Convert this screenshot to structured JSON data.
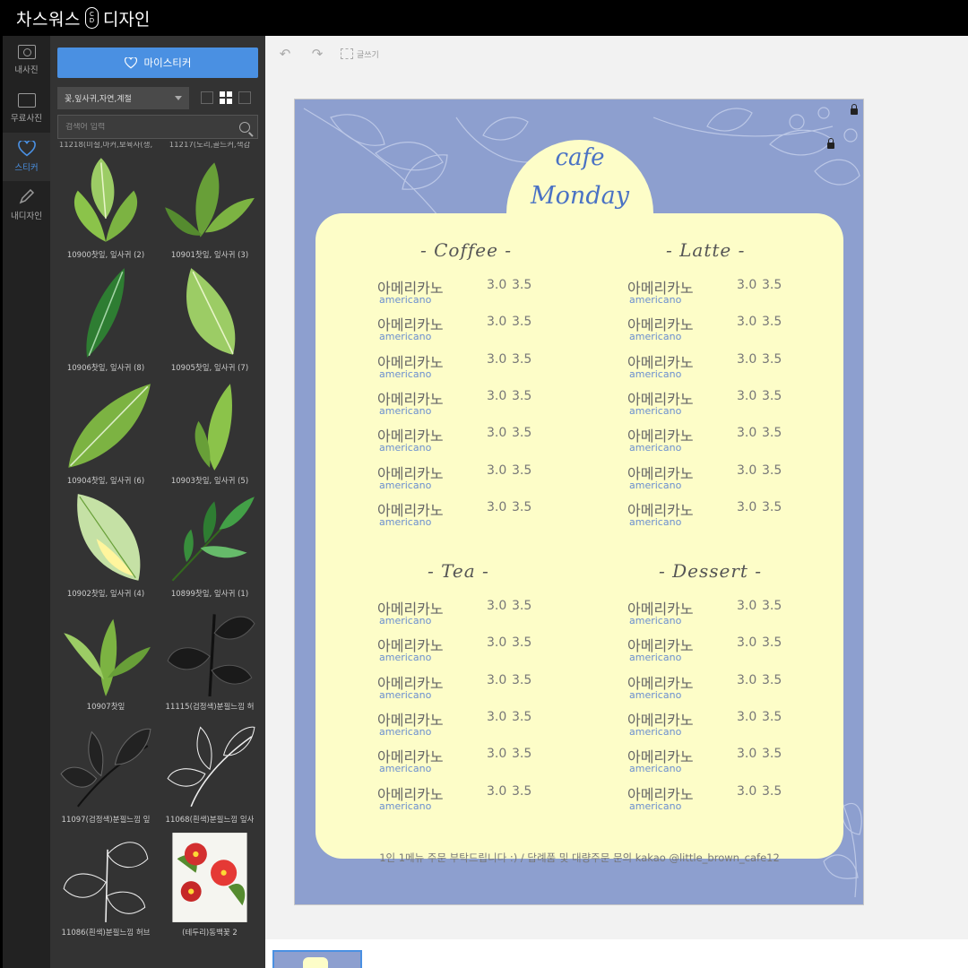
{
  "app": {
    "title_left": "차스워스",
    "logo_letters": [
      "C",
      "D"
    ],
    "title_right": "디자인"
  },
  "rail": [
    {
      "label": "내사진",
      "active": false
    },
    {
      "label": "무료사진",
      "active": false
    },
    {
      "label": "스티커",
      "active": true
    },
    {
      "label": "내디자인",
      "active": false
    }
  ],
  "panel": {
    "my_sticker_label": "마이스티커",
    "category_value": "꽃,잎사귀,자연,계절",
    "search_placeholder": "검색어 입력",
    "cut_labels": [
      "11218(미철,마커,보육사(생,",
      "11217(노리,골드커,색감"
    ],
    "stickers": [
      {
        "label": "10900찻잎, 잎사귀 (2)",
        "icon": "mint-leaf-icon"
      },
      {
        "label": "10901찻잎, 잎사귀 (3)",
        "icon": "tea-leaf-icon"
      },
      {
        "label": "10906찻잎, 잎사귀 (8)",
        "icon": "dark-leaf-icon"
      },
      {
        "label": "10905찻잎, 잎사귀 (7)",
        "icon": "single-leaf-icon"
      },
      {
        "label": "10904찻잎, 잎사귀 (6)",
        "icon": "broad-leaf-icon"
      },
      {
        "label": "10903찻잎, 잎사귀 (5)",
        "icon": "leaf-pair-icon"
      },
      {
        "label": "10902찻잎, 잎사귀 (4)",
        "icon": "yellow-leaf-icon"
      },
      {
        "label": "10899찻잎, 잎사귀 (1)",
        "icon": "leaf-sprig-icon"
      },
      {
        "label": "10907찻잎",
        "icon": "tea-sprig-icon"
      },
      {
        "label": "11115(검정색)분필느낌 허",
        "icon": "chalk-herb-icon"
      },
      {
        "label": "11097(검정색)분필느낌 잎",
        "icon": "chalk-leaf-icon"
      },
      {
        "label": "11068(흰색)분필느낌 잎사",
        "icon": "white-chalk-leaf-icon"
      },
      {
        "label": "11086(흰색)분필느낌 허브",
        "icon": "white-chalk-herb-icon"
      },
      {
        "label": "(테두리)동백꽃 2",
        "icon": "camellia-icon"
      }
    ]
  },
  "toolbar": {
    "undo": "↶",
    "redo": "↷",
    "ruler_label": "글쓰기"
  },
  "menu": {
    "brand_line1": "cafe",
    "brand_line2": "Monday",
    "sections": [
      {
        "title": "- Coffee -"
      },
      {
        "title": "- Latte -"
      },
      {
        "title": "- Tea -"
      },
      {
        "title": "- Dessert -"
      }
    ],
    "item": {
      "name_ko": "아메리카노",
      "name_en": "americano",
      "price_small": "3.0",
      "price_large": "3.5"
    },
    "footer": "1인 1메뉴 주문 부탁드립니다 :)   /   답례품 및 대량주문 문의 kakao @little_brown_cafe12"
  },
  "colors": {
    "accent": "#4a90e2",
    "menu_bg": "#fdfdc8",
    "canvas_bg": "#8d9fcf",
    "brand_text": "#4a72c4"
  }
}
